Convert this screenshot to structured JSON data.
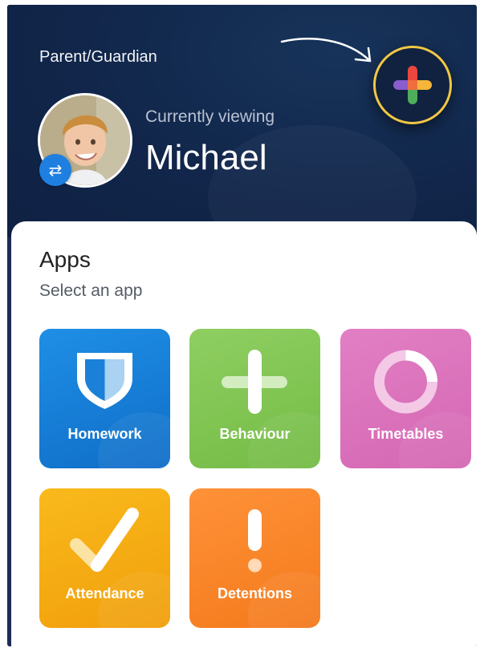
{
  "header": {
    "role": "Parent/Guardian",
    "viewing_label": "Currently viewing",
    "child_name": "Michael"
  },
  "apps_section": {
    "title": "Apps",
    "subtitle": "Select an app"
  },
  "apps": [
    {
      "label": "Homework",
      "icon": "shield-icon",
      "color": "#1f8fe6"
    },
    {
      "label": "Behaviour",
      "icon": "plus-icon",
      "color": "#8fcf62"
    },
    {
      "label": "Timetables",
      "icon": "donut-icon",
      "color": "#e27fc4"
    },
    {
      "label": "Attendance",
      "icon": "checkmark-icon",
      "color": "#f9ba1c"
    },
    {
      "label": "Detentions",
      "icon": "exclamation-icon",
      "color": "#ff9138"
    }
  ],
  "colors": {
    "header_bg": "#11264a",
    "add_button_ring": "#f2c744",
    "switch_badge": "#1e7fe0"
  }
}
